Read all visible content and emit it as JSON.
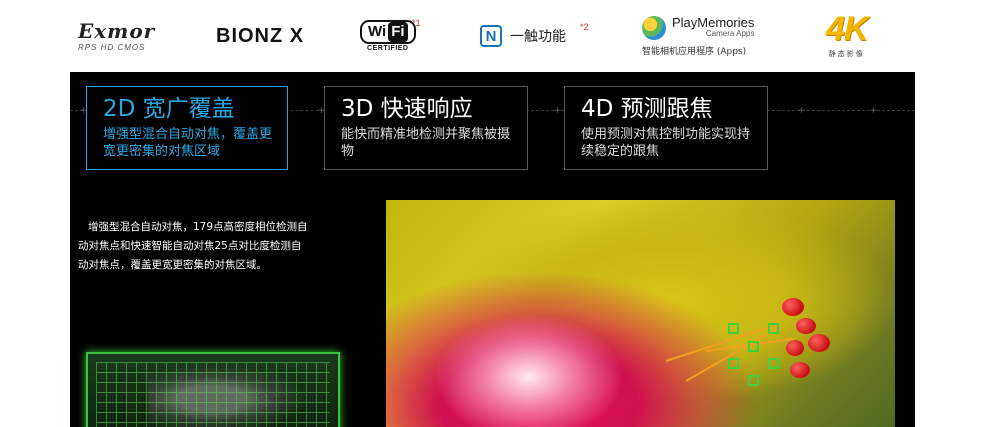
{
  "logos": {
    "exmor": {
      "name": "Exmor",
      "sub": "RPS HD CMOS"
    },
    "bionz": {
      "name": "BIONZ X"
    },
    "wifi": {
      "wi": "Wi",
      "fi": "Fi",
      "cert": "CERTIFIED",
      "note": "*1"
    },
    "nfc": {
      "mark": "N",
      "label": "一触功能",
      "note": "*2"
    },
    "playmemories": {
      "title": "PlayMemories",
      "sub": "Camera Apps",
      "caption": "智能相机应用程序 (Apps)"
    },
    "fourk": {
      "text": "4K",
      "caption": "静态影像"
    }
  },
  "features": [
    {
      "title": "2D 宽广覆盖",
      "desc": "增强型混合自动对焦，覆盖更宽更密集的对焦区域",
      "active": true
    },
    {
      "title": "3D 快速响应",
      "desc": "能快而精准地检测并聚焦被摄物",
      "active": false
    },
    {
      "title": "4D 预测跟焦",
      "desc": "使用预测对焦控制功能实现持续稳定的跟焦",
      "active": false
    }
  ],
  "body": {
    "text": "增强型混合自动对焦，179点高密度相位检测自动对焦点和快速智能自动对焦25点对比度检测自动对焦点，覆盖更宽更密集的对焦区域。"
  },
  "colors": {
    "accent": "#2aa7e3",
    "panel": "#000000",
    "af_green": "#3fd23f",
    "fourk_gold": "#f5b400"
  }
}
